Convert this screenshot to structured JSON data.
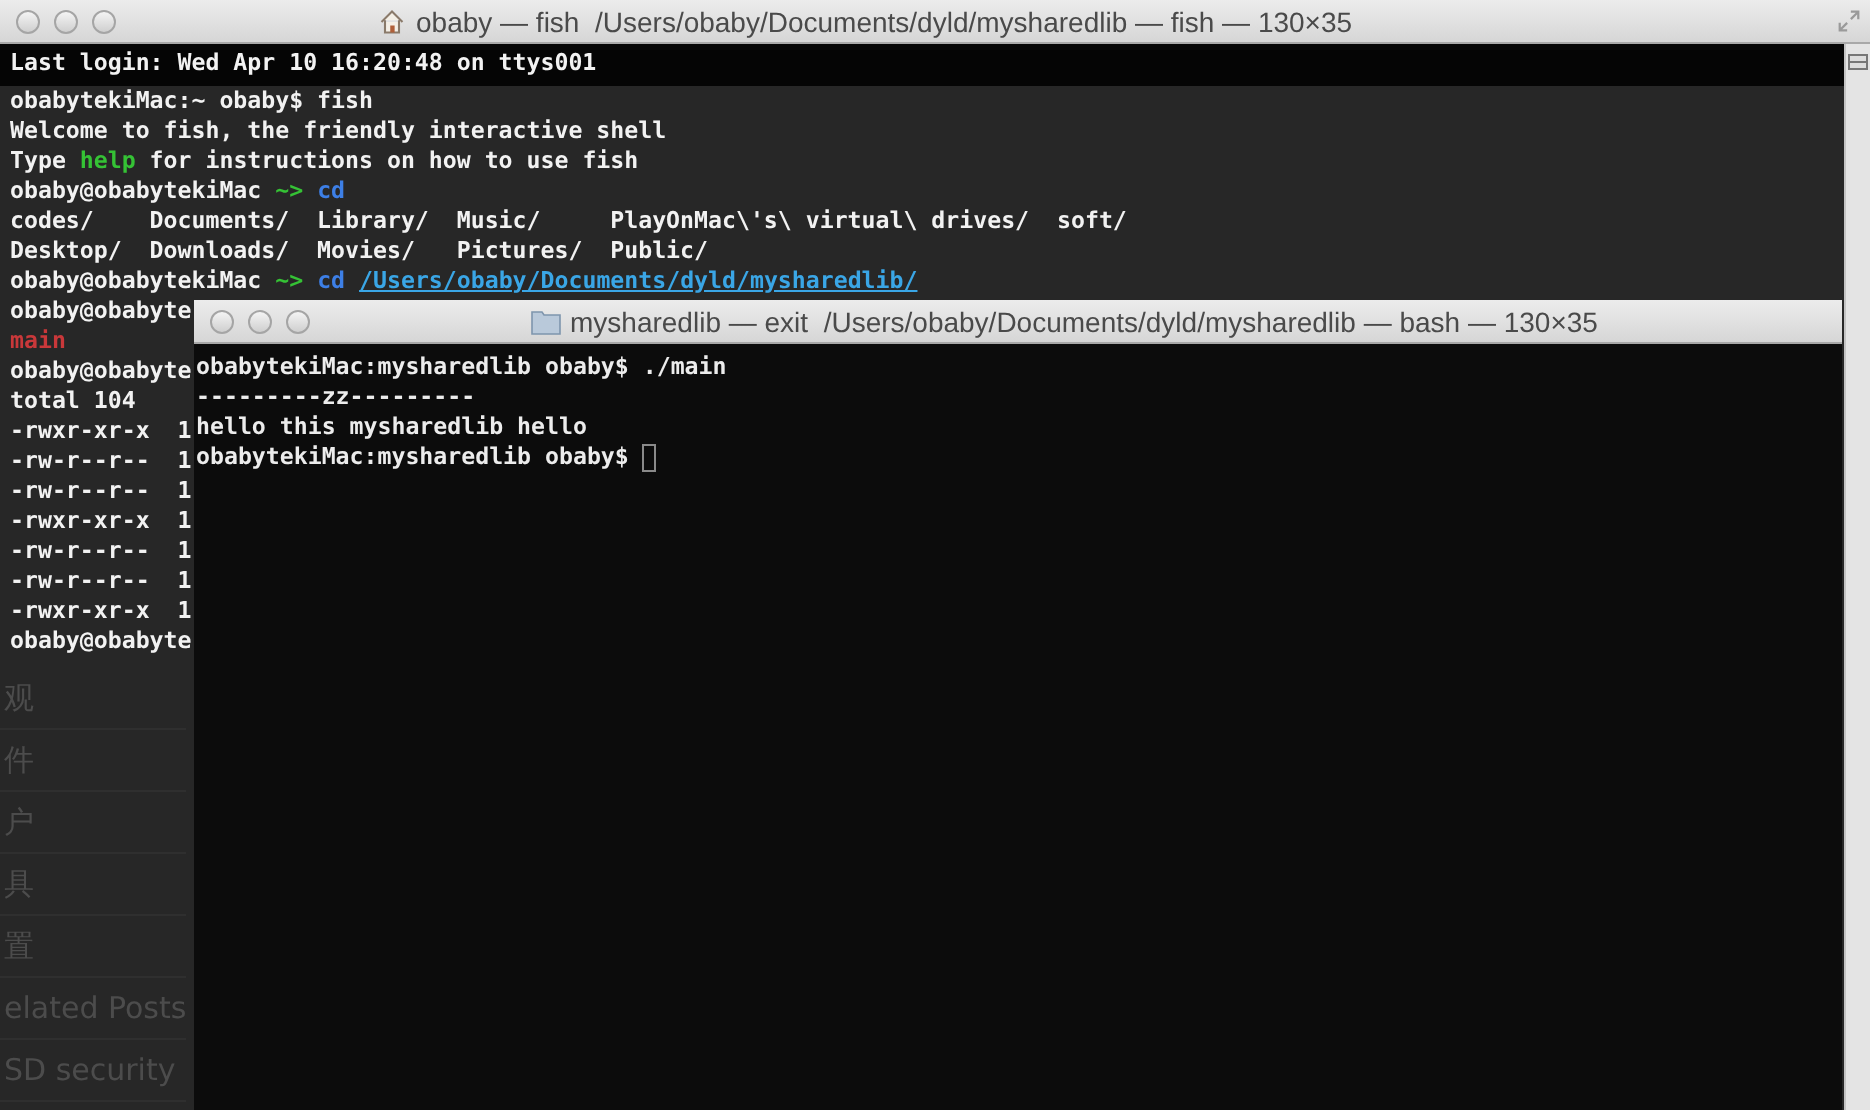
{
  "back_window": {
    "title": "obaby — fish  /Users/obaby/Documents/dyld/mysharedlib — fish — 130×35",
    "lines": [
      {
        "segments": [
          {
            "text": "Last login: Wed Apr 10 16:20:48 on ttys001",
            "kind": "plain"
          }
        ]
      },
      {
        "segments": [
          {
            "text": "obabytekiMac:~ obaby$ fish",
            "kind": "plain"
          }
        ]
      },
      {
        "segments": [
          {
            "text": "Welcome to fish, the friendly interactive shell",
            "kind": "plain"
          }
        ]
      },
      {
        "segments": [
          {
            "text": "Type ",
            "kind": "plain"
          },
          {
            "text": "help",
            "kind": "green"
          },
          {
            "text": " for instructions on how to use fish",
            "kind": "plain"
          }
        ]
      },
      {
        "segments": [
          {
            "text": "obaby@obabytekiMac ",
            "kind": "plain"
          },
          {
            "text": "~> ",
            "kind": "green"
          },
          {
            "text": "cd",
            "kind": "blue"
          }
        ]
      },
      {
        "segments": [
          {
            "text": "codes/    Documents/  Library/  Music/     PlayOnMac\\'s\\ virtual\\ drives/  soft/",
            "kind": "plain"
          }
        ]
      },
      {
        "segments": [
          {
            "text": "Desktop/  Downloads/  Movies/   Pictures/  Public/",
            "kind": "plain"
          }
        ]
      },
      {
        "segments": [
          {
            "text": "obaby@obabytekiMac ",
            "kind": "plain"
          },
          {
            "text": "~> ",
            "kind": "green"
          },
          {
            "text": "cd ",
            "kind": "blue"
          },
          {
            "text": "/Users/obaby/Documents/dyld/mysharedlib/",
            "kind": "link"
          }
        ]
      },
      {
        "segments": [
          {
            "text": "obaby@obabyte",
            "kind": "plain"
          }
        ]
      },
      {
        "segments": [
          {
            "text": "main",
            "kind": "red"
          }
        ]
      },
      {
        "segments": [
          {
            "text": "obaby@obabyte",
            "kind": "plain"
          }
        ]
      },
      {
        "segments": [
          {
            "text": "total 104",
            "kind": "plain"
          }
        ]
      },
      {
        "segments": [
          {
            "text": "-rwxr-xr-x  1",
            "kind": "plain"
          }
        ]
      },
      {
        "segments": [
          {
            "text": "-rw-r--r--  1",
            "kind": "plain"
          }
        ]
      },
      {
        "segments": [
          {
            "text": "-rw-r--r--  1",
            "kind": "plain"
          }
        ]
      },
      {
        "segments": [
          {
            "text": "-rwxr-xr-x  1",
            "kind": "plain"
          }
        ]
      },
      {
        "segments": [
          {
            "text": "-rw-r--r--  1",
            "kind": "plain"
          }
        ]
      },
      {
        "segments": [
          {
            "text": "-rw-r--r--  1",
            "kind": "plain"
          }
        ]
      },
      {
        "segments": [
          {
            "text": "-rwxr-xr-x  1",
            "kind": "plain"
          }
        ]
      },
      {
        "segments": [
          {
            "text": "obaby@obabyte",
            "kind": "plain"
          }
        ]
      }
    ],
    "page_behind": [
      "观",
      "件",
      "户",
      "具",
      "置",
      "elated Posts",
      "SD security"
    ]
  },
  "front_window": {
    "title": "mysharedlib — exit  /Users/obaby/Documents/dyld/mysharedlib — bash — 130×35",
    "lines": [
      {
        "text": "obabytekiMac:mysharedlib obaby$ ./main",
        "cursor": false
      },
      {
        "text": "---------zz---------",
        "cursor": false
      },
      {
        "text": "hello this mysharedlib hello",
        "cursor": false
      },
      {
        "text": "obabytekiMac:mysharedlib obaby$ ",
        "cursor": true
      }
    ]
  }
}
